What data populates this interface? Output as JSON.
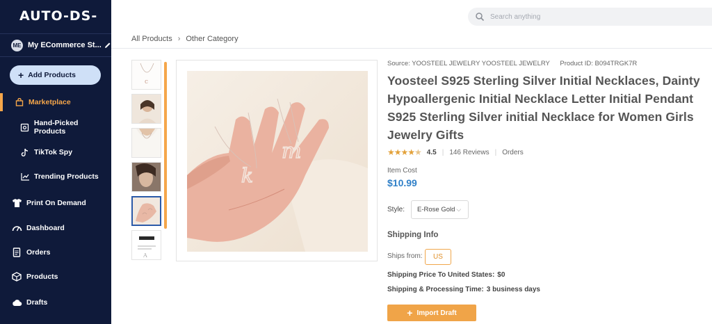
{
  "app": {
    "logo": "AUTO-DS-"
  },
  "store": {
    "initials": "ME",
    "name": "My ECommerce St..."
  },
  "sidebar": {
    "add_button": "Add Products",
    "items": [
      {
        "label": "Marketplace",
        "icon": "shop-icon",
        "active": true
      },
      {
        "label": "Hand-Picked Products",
        "icon": "hand-picked-icon"
      },
      {
        "label": "TikTok Spy",
        "icon": "tiktok-icon"
      },
      {
        "label": "Trending Products",
        "icon": "trending-icon"
      },
      {
        "label": "Print On Demand",
        "icon": "print-on-demand-icon"
      },
      {
        "label": "Dashboard",
        "icon": "dashboard-icon"
      },
      {
        "label": "Orders",
        "icon": "orders-icon"
      },
      {
        "label": "Products",
        "icon": "products-icon"
      },
      {
        "label": "Drafts",
        "icon": "drafts-icon"
      }
    ]
  },
  "search": {
    "placeholder": "Search anything"
  },
  "breadcrumb": {
    "root": "All Products",
    "current": "Other Category"
  },
  "product": {
    "source": "Source: YOOSTEEL JEWELRY YOOSTEEL JEWELRY",
    "product_id": "Product ID: B094TRGK7R",
    "title": "Yoosteel S925 Sterling Silver Initial Necklaces, Dainty Hypoallergenic Initial Necklace Letter Initial Pendant S925 Sterling Silver initial Necklace for Women Girls Jewelry Gifts",
    "rating": 4.5,
    "rating_text": "4.5",
    "reviews": "146 Reviews",
    "orders": "Orders",
    "cost_label": "Item Cost",
    "price": "$10.99",
    "style_label": "Style:",
    "style_value": "E-Rose Gold",
    "shipping_header": "Shipping Info",
    "ships_from_label": "Ships from:",
    "ships_from_value": "US",
    "shipping_price_label": "Shipping Price To United States:",
    "shipping_price_value": "$0",
    "shipping_time_label": "Shipping & Processing Time:",
    "shipping_time_value": "3 business days",
    "import_button": "Import Draft"
  },
  "colors": {
    "sidebar_bg": "#0f1a3a",
    "accent": "#f5a64a",
    "price": "#3080c8",
    "selected_thumb": "#2b5aa8"
  }
}
